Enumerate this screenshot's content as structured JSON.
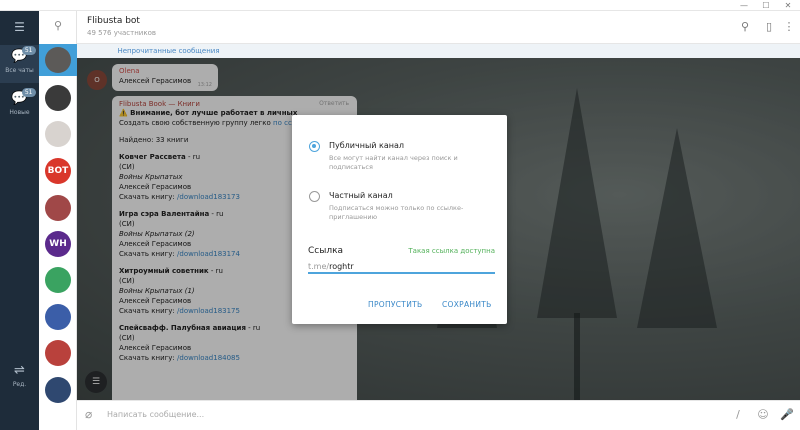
{
  "window": {
    "controls": [
      "—",
      "☐",
      "✕"
    ]
  },
  "folders": {
    "menu_icon": "hamburger-icon",
    "items": [
      {
        "label": "Все чаты",
        "badge": "51",
        "icon": "chat-bubble-icon"
      },
      {
        "label": "Новые",
        "badge": "51",
        "icon": "chat-bubble-icon"
      },
      {
        "label": "Ред.",
        "badge": "",
        "icon": "sliders-icon"
      }
    ]
  },
  "chat_list": {
    "avatars": [
      {
        "text": "",
        "color": "#5c5a58",
        "mini": ""
      },
      {
        "text": "",
        "color": "#3a3a3a",
        "mini": ""
      },
      {
        "text": "",
        "color": "#d8d3cf",
        "mini": ""
      },
      {
        "text": "BOT",
        "color": "#d9372b",
        "mini": ""
      },
      {
        "text": "",
        "color": "#a04848",
        "mini": ""
      },
      {
        "text": "WH",
        "color": "#5b2a8c",
        "mini": ""
      },
      {
        "text": "",
        "color": "#3aa361",
        "mini": ""
      },
      {
        "text": "",
        "color": "#3b5ea8",
        "mini": ""
      },
      {
        "text": "",
        "color": "#b9413c",
        "mini": ""
      },
      {
        "text": "",
        "color": "#2f4870",
        "mini": ""
      }
    ]
  },
  "header": {
    "title": "Flibusta bot",
    "subtitle": "49 576 участников"
  },
  "unread_bar": {
    "label": "Непрочитанные сообщения"
  },
  "messages": {
    "small": {
      "avatar": "O",
      "sender": "Olena",
      "text": "Алексей Герасимов",
      "time": "13:12"
    },
    "main": {
      "header": "Flibusta Book — Книги",
      "reply": "Ответить",
      "warning": "⚠️ Внимание, бот лучше работает в личных",
      "create": "Создать свою собственную группу легко",
      "create_link": "по ссылке",
      "found": "Найдено: 33 книги",
      "books": [
        {
          "title": "Ковчег Рассвета",
          "lang": " - ru",
          "si": "(СИ)",
          "series": "Войны Крыпатых",
          "author": "Алексей Герасимов",
          "dl_label": "Скачать книгу: ",
          "dl": "/download183173"
        },
        {
          "title": "Игра сэра Валентайна",
          "lang": " - ru",
          "si": "(СИ)",
          "series": "Войны Крыпатых (2)",
          "author": "Алексей Герасимов",
          "dl_label": "Скачать книгу: ",
          "dl": "/download183174"
        },
        {
          "title": "Хитроумный советник",
          "lang": " - ru",
          "si": "(СИ)",
          "series": "Войны Крыпатых (1)",
          "author": "Алексей Герасимов",
          "dl_label": "Скачать книгу: ",
          "dl": "/download183175"
        },
        {
          "title": "Спейсвафф. Палубная авиация",
          "lang": " - ru",
          "si": "(СИ)",
          "series": "",
          "author": "Алексей Герасимов",
          "dl_label": "Скачать книгу: ",
          "dl": "/download184085"
        }
      ]
    }
  },
  "dialog": {
    "public": {
      "title": "Публичный канал",
      "desc": "Все могут найти канал через поиск и подписаться"
    },
    "private": {
      "title": "Частный канал",
      "desc": "Подписаться можно только по ссылке-приглашению"
    },
    "link_label": "Ссылка",
    "link_status": "Такая ссылка доступна",
    "link_prefix": "t.me/",
    "link_value": "roghtr",
    "skip": "ПРОПУСТИТЬ",
    "save": "СОХРАНИТЬ"
  },
  "composer": {
    "placeholder": "Написать сообщение..."
  },
  "colors": {
    "accent": "#4ea4dc",
    "sidebar": "#1e2c3a",
    "available": "#53b15a"
  }
}
